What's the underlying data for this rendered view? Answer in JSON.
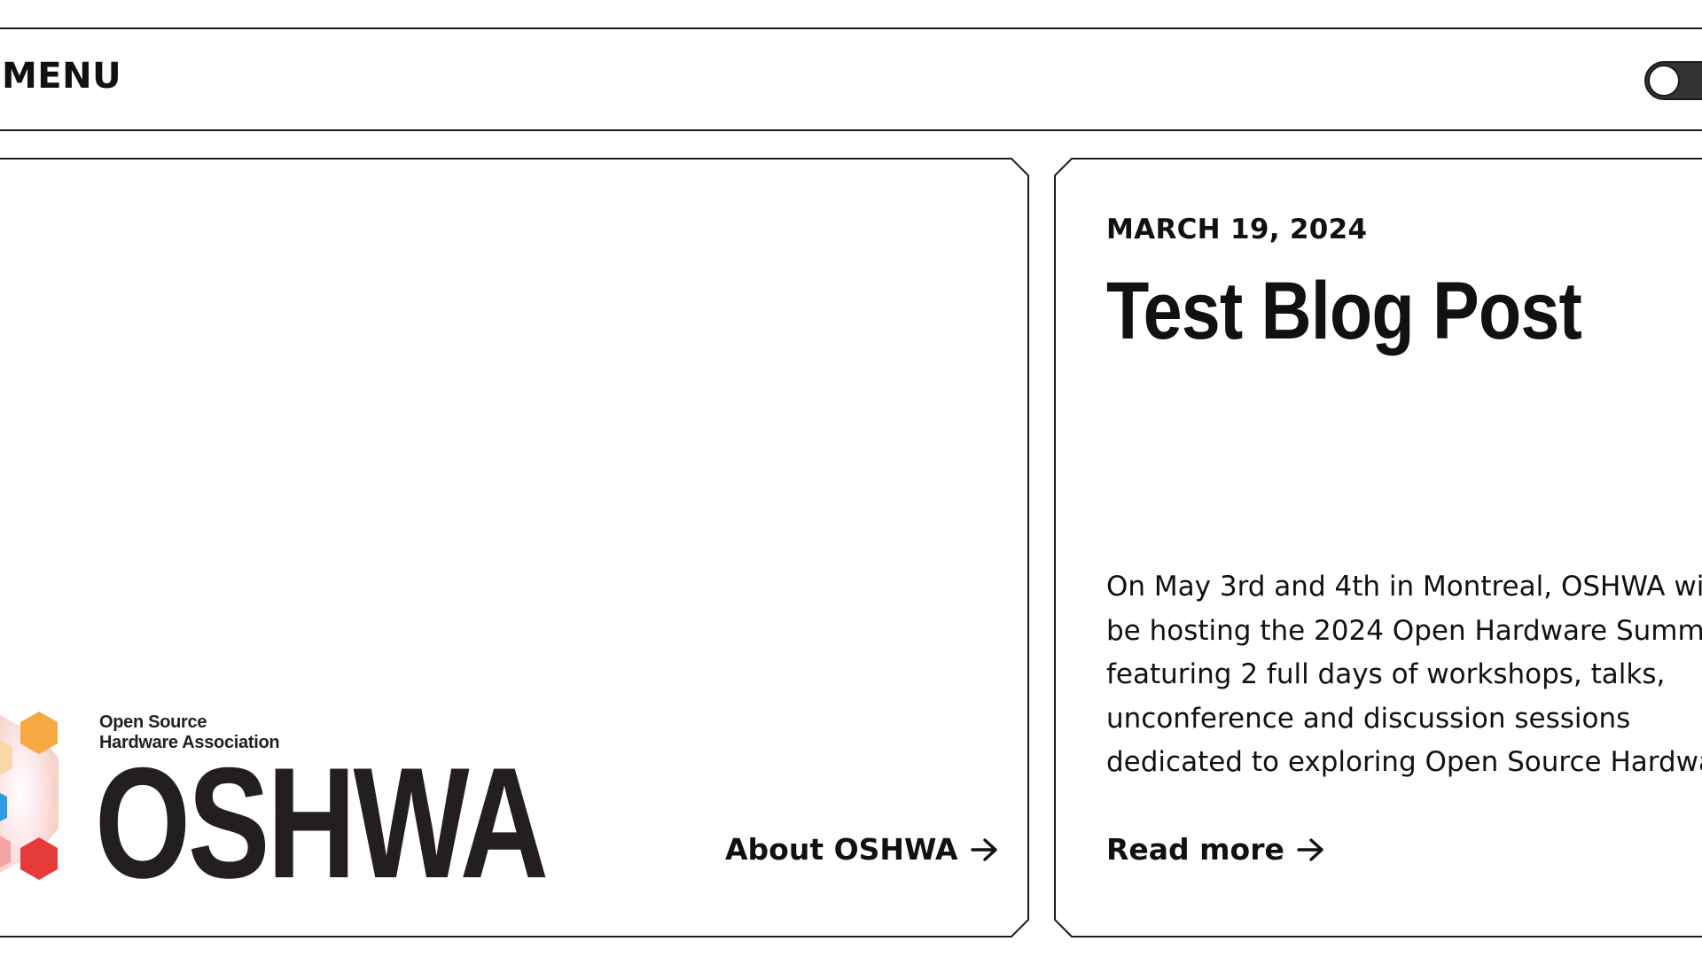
{
  "header": {
    "menu_label": "MENU",
    "toggle_icon": "theme-toggle-switch"
  },
  "about_card": {
    "logo": {
      "line1": "Open Source",
      "line2": "Hardware Association",
      "wordmark": "OSHWA",
      "colors": [
        "#f6a942",
        "#e63b3b",
        "#2f9be0"
      ]
    },
    "link_label": "About OSHWA",
    "link_icon": "arrow-right-icon"
  },
  "post_card": {
    "date": "MARCH 19, 2024",
    "title": "Test Blog Post",
    "excerpt_lines": [
      "On May 3rd and 4th in Montreal, OSHWA wi",
      "be hosting the 2024 Open Hardware Summ",
      "featuring 2 full days of workshops, talks,",
      "unconference and discussion sessions",
      "dedicated to exploring Open Source Hardwa"
    ],
    "link_label": "Read more",
    "link_icon": "arrow-right-icon"
  }
}
